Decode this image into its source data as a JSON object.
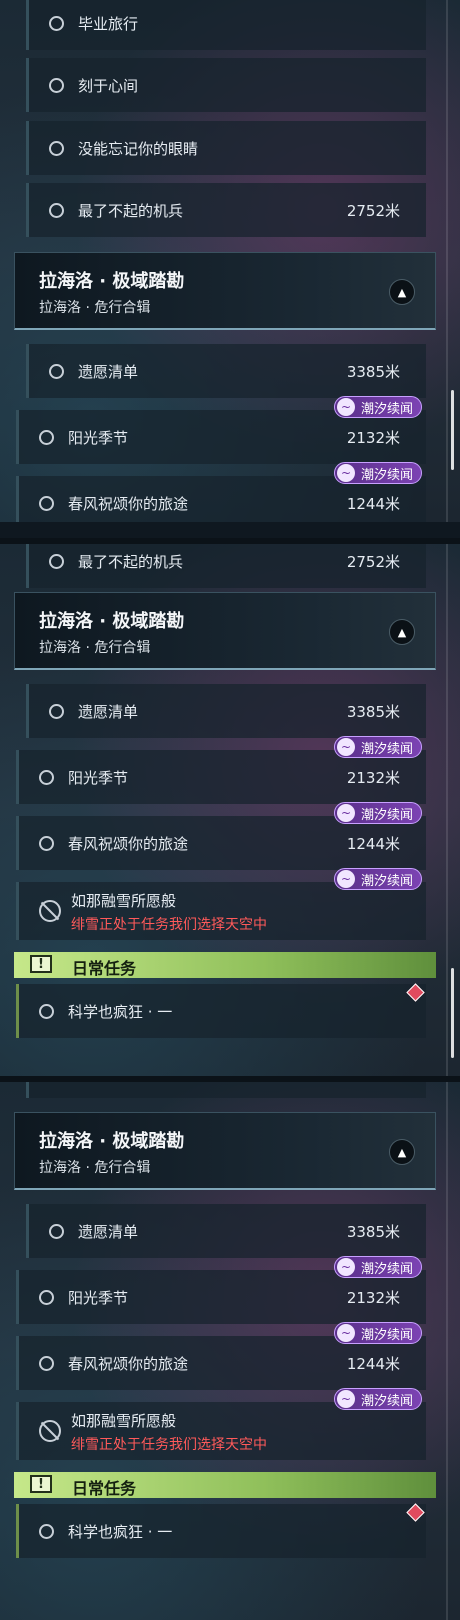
{
  "region_header": {
    "title": "拉海洛 · 极域踏勘",
    "subtitle": "拉海洛 · 危行合辑",
    "collapse_icon": "chevron-up-icon"
  },
  "quests_top": [
    {
      "label": "毕业旅行"
    },
    {
      "label": "刻于心间"
    },
    {
      "label": "没能忘记你的眼睛"
    },
    {
      "label": "最了不起的机兵",
      "distance": "2752米"
    }
  ],
  "region_quests": [
    {
      "label": "遗愿清单",
      "distance": "3385米"
    },
    {
      "label": "阳光季节",
      "distance": "2132米",
      "badge": "潮汐续闻"
    },
    {
      "label": "春风祝颂你的旅途",
      "distance": "1244米",
      "badge": "潮汐续闻"
    }
  ],
  "failed_quest": {
    "title": "如那融雪所愿般",
    "reason": "绯雪正处于任务我们选择天空中",
    "badge": "潮汐续闻",
    "icon": "blocked-icon"
  },
  "daily": {
    "section_label": "日常任务",
    "icon_text": "!",
    "quest": "科学也疯狂 · 一"
  },
  "colors": {
    "badge": "#6a35a0",
    "daily_green": "#a8d66e",
    "error": "#ff5a5a"
  }
}
